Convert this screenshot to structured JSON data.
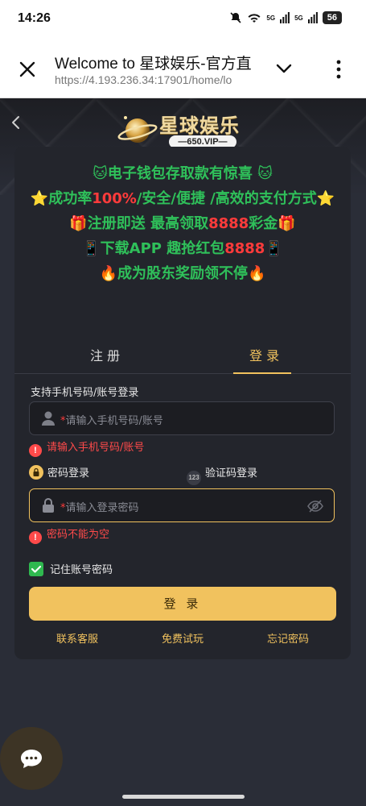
{
  "status_bar": {
    "time": "14:26",
    "battery": "56",
    "signal_1": "5G",
    "signal_2": "5G"
  },
  "browser": {
    "title": "Welcome to 星球娱乐-官方直",
    "url": "https://4.193.236.34:17901/home/lo"
  },
  "brand": {
    "name": "星球娱乐",
    "badge": "—650.VIP—"
  },
  "promo": {
    "line1": "🐱电子钱包存取款有惊喜 🐱",
    "line2_prefix": "⭐成功率",
    "line2_highlight": "100%",
    "line2_suffix": "/安全/便捷 /高效的支付方式⭐",
    "line3_prefix": "🎁注册即送 最高领取",
    "line3_highlight": "8888",
    "line3_suffix": "彩金🎁",
    "line4_prefix": "📱下载APP 趣抢红包",
    "line4_highlight": "8888",
    "line4_suffix": "📱",
    "line5": "🔥成为股东奖励领不停🔥"
  },
  "tabs": {
    "register": "注 册",
    "login": "登 录",
    "active": "login"
  },
  "form": {
    "support_label": "支持手机号码/账号登录",
    "account_placeholder": "请输入手机号码/账号",
    "account_error": "请输入手机号码/账号",
    "mode_password": "密码登录",
    "mode_code": "验证码登录",
    "mode_code_icon_text": "123",
    "password_placeholder": "请输入登录密码",
    "password_error": "密码不能为空",
    "remember": "记住账号密码",
    "remember_checked": true,
    "submit": "登 录"
  },
  "links": {
    "service": "联系客服",
    "trial": "免费试玩",
    "forgot": "忘记密码"
  },
  "colors": {
    "accent": "#f1c25e",
    "promo_green": "#2fc05a",
    "error_red": "#ff4a4a",
    "card_bg": "#23252c",
    "page_bg": "#2a2d37"
  }
}
